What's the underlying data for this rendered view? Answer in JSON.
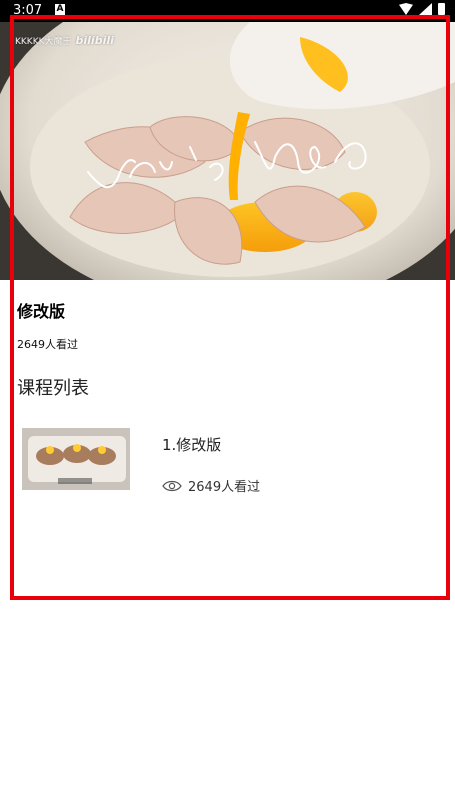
{
  "status_bar": {
    "time": "3:07",
    "notification_letter": "A"
  },
  "video": {
    "watermark_user": "KKKKK大魔王",
    "watermark_brand": "bilibili",
    "overlay_script_text": "Vic's Vlog"
  },
  "course": {
    "title": "修改版",
    "views": "2649人看过"
  },
  "section_title": "课程列表",
  "lessons": [
    {
      "title": "1.修改版",
      "views": "2649人看过"
    }
  ],
  "colors": {
    "highlight_border": "#e8000b",
    "status_bar_bg": "#000000"
  },
  "icons": [
    "wifi-icon",
    "signal-icon",
    "battery-icon",
    "eye-icon"
  ]
}
